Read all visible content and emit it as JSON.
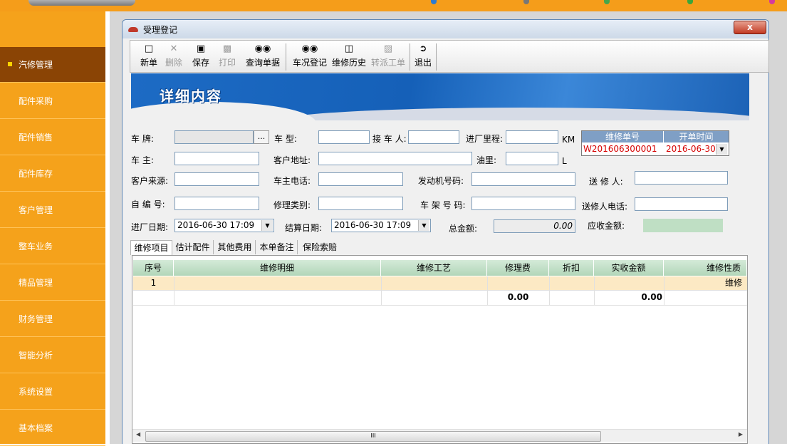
{
  "sidebar": {
    "items": [
      {
        "label": "汽修管理",
        "active": true
      },
      {
        "label": "配件采购"
      },
      {
        "label": "配件销售"
      },
      {
        "label": "配件库存"
      },
      {
        "label": "客户管理"
      },
      {
        "label": "整车业务"
      },
      {
        "label": "精品管理"
      },
      {
        "label": "财务管理"
      },
      {
        "label": "智能分析"
      },
      {
        "label": "系统设置"
      },
      {
        "label": "基本档案"
      }
    ]
  },
  "window": {
    "title": "受理登记",
    "close_label": "x"
  },
  "toolbar": {
    "new": "新单",
    "delete": "删除",
    "save": "保存",
    "print": "打印",
    "query": "查询单据",
    "inspect": "车况登记",
    "history": "维修历史",
    "transfer": "转派工单",
    "exit": "退出"
  },
  "banner": {
    "heading": "详细内容"
  },
  "form": {
    "plate_label": "车  牌:",
    "plate_value": "",
    "model_label": "车  型:",
    "model_value": "",
    "receiver_label": "接 车 人:",
    "receiver_value": "",
    "mileage_label": "进厂里程:",
    "mileage_value": "",
    "mileage_unit": "KM",
    "owner_label": "车  主:",
    "owner_value": "",
    "address_label": "客户地址:",
    "address_value": "",
    "fuel_label": "油里:",
    "fuel_value": "",
    "fuel_unit": "L",
    "source_label": "客户来源:",
    "source_value": "",
    "owner_phone_label": "车主电话:",
    "owner_phone_value": "",
    "engine_label": "发动机号码:",
    "engine_value": "",
    "sender_label": "送 修 人:",
    "sender_value": "",
    "self_no_label": "自 编 号:",
    "self_no_value": "",
    "repair_type_label": "修理类别:",
    "repair_type_value": "",
    "frame_label": "车 架 号 码:",
    "frame_value": "",
    "sender_phone_label": "送修人电话:",
    "sender_phone_value": "",
    "in_date_label": "进厂日期:",
    "in_date_value": "2016-06-30 17:09",
    "settle_date_label": "结算日期:",
    "settle_date_value": "2016-06-30 17:09",
    "total_label": "总金额:",
    "total_value": "0.00",
    "receivable_label": "应收金额:",
    "receivable_value": ""
  },
  "order": {
    "no_label": "维修单号",
    "no_value": "W201606300001",
    "time_label": "开单时间",
    "time_value": "2016-06-30"
  },
  "tabs": [
    "维修项目",
    "估计配件",
    "其他费用",
    "本单备注",
    "保险索赔"
  ],
  "grid": {
    "columns": [
      "序号",
      "维修明细",
      "维修工艺",
      "修理费",
      "折扣",
      "实收金额",
      "维修性质"
    ],
    "rows": [
      {
        "no": "1",
        "detail": "",
        "craft": "",
        "fee": "",
        "discount": "",
        "amount": "",
        "nature": "维修"
      }
    ],
    "totals": {
      "fee": "0.00",
      "amount": "0.00"
    },
    "scroll_grip": "III"
  },
  "colors": {
    "sidebar": "#f5a21b",
    "sidebar_active": "#8a4405",
    "banner": "#1560b8",
    "grid_header": "#b2d6b9",
    "row_highlight": "#fce9c4",
    "order_text": "#d60000"
  }
}
